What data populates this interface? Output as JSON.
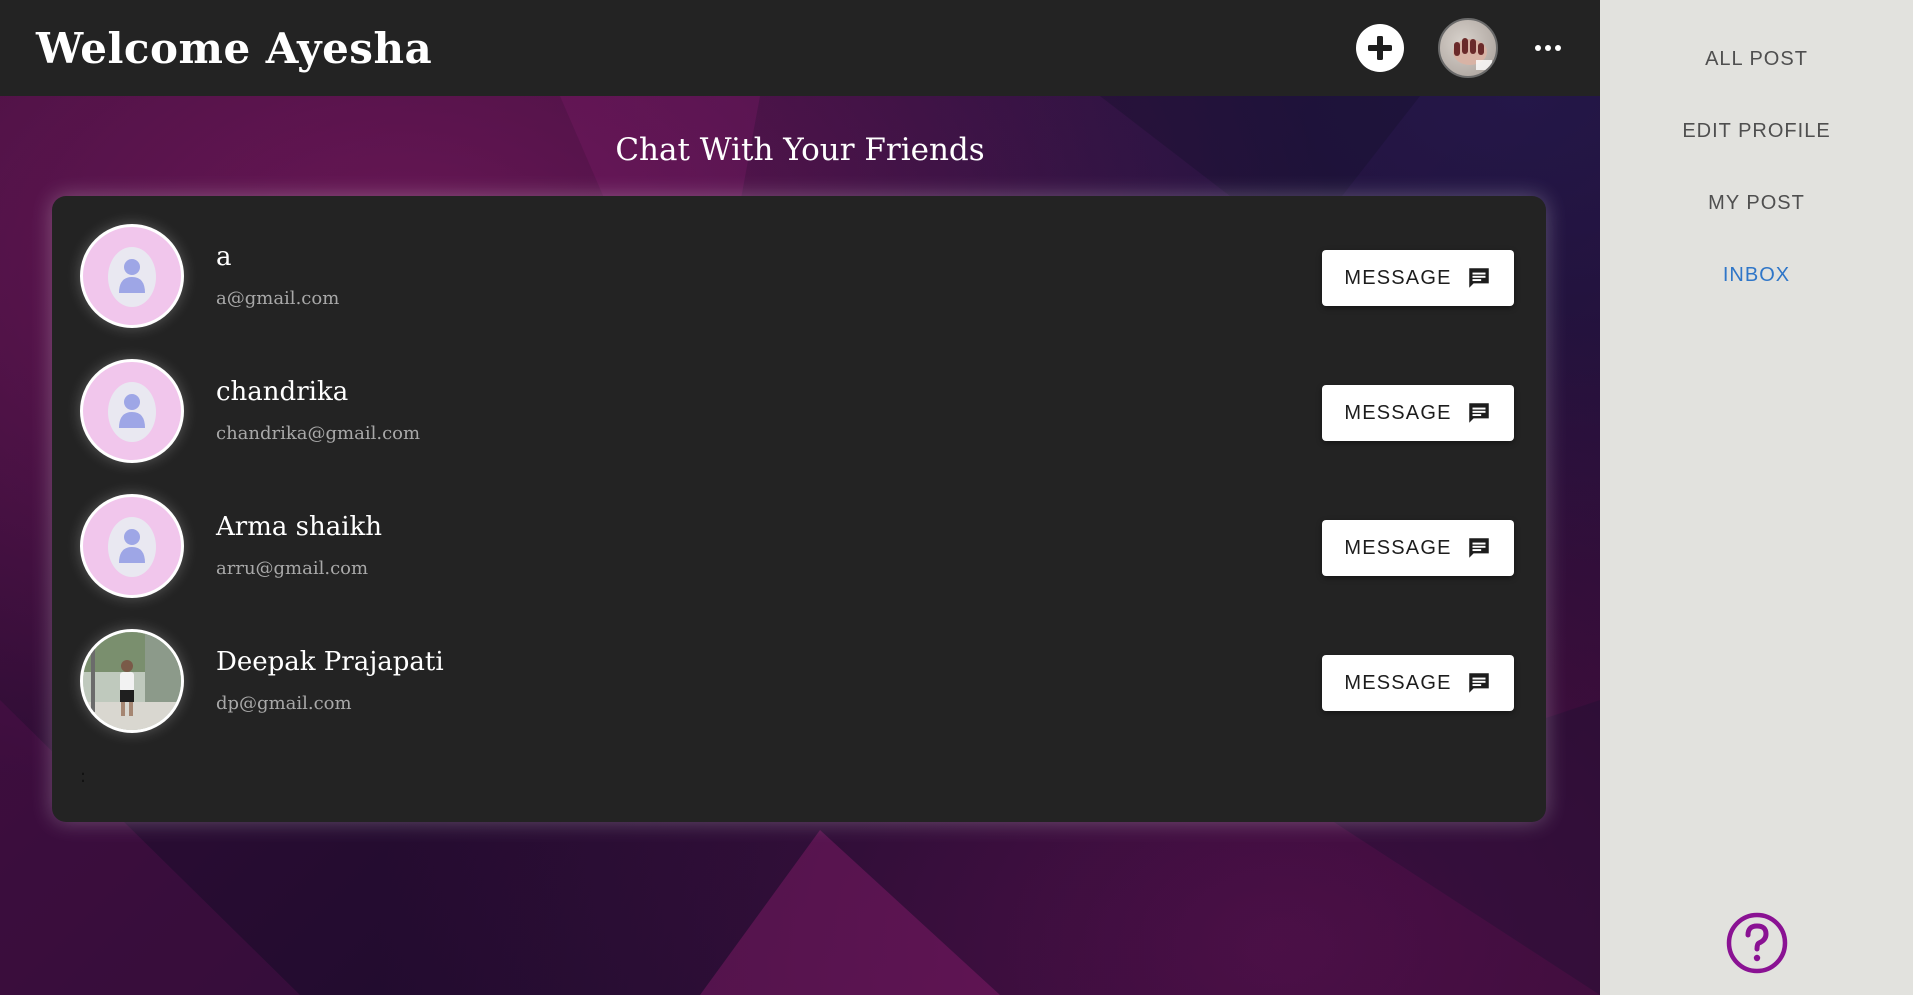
{
  "header": {
    "welcome_text": "Welcome Ayesha",
    "add_icon": "plus-circle-icon",
    "more_icon": "more-horizontal-icon"
  },
  "main": {
    "section_title": "Chat With Your Friends",
    "friends": [
      {
        "name": "a",
        "email": "a@gmail.com",
        "avatar": "default-person-icon",
        "button_label": "MESSAGE",
        "button_icon": "chat-bubble-icon"
      },
      {
        "name": "chandrika",
        "email": "chandrika@gmail.com",
        "avatar": "default-person-icon",
        "button_label": "MESSAGE",
        "button_icon": "chat-bubble-icon"
      },
      {
        "name": "Arma shaikh",
        "email": "arru@gmail.com",
        "avatar": "default-person-icon",
        "button_label": "MESSAGE",
        "button_icon": "chat-bubble-icon"
      },
      {
        "name": "Deepak Prajapati",
        "email": "dp@gmail.com",
        "avatar": "photo",
        "button_label": "MESSAGE",
        "button_icon": "chat-bubble-icon"
      }
    ],
    "trailing_text": ":"
  },
  "sidebar": {
    "items": [
      {
        "label": "ALL POST",
        "active": false
      },
      {
        "label": "EDIT PROFILE",
        "active": false
      },
      {
        "label": "MY POST",
        "active": false
      },
      {
        "label": "INBOX",
        "active": true
      }
    ],
    "help_icon": "help-circle-icon"
  },
  "colors": {
    "topbar": "#232323",
    "card": "#232323",
    "sidebar": "#e2e2de",
    "active_nav": "#2f76c8",
    "help": "#8a1293",
    "avatar_bg": "#f1c6ec"
  }
}
